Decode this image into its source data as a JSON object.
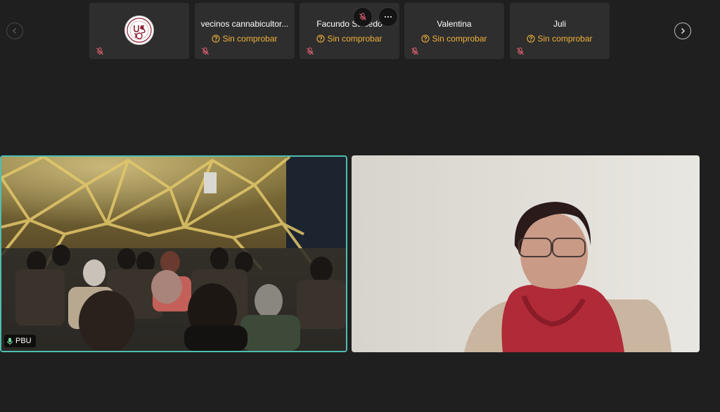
{
  "navigation": {
    "prev_icon": "chevron-left-icon",
    "next_icon": "chevron-right-icon"
  },
  "participants": [
    {
      "name": "",
      "avatar": "university-logo",
      "status": "",
      "muted": true
    },
    {
      "name": "vecinos cannabicultor...",
      "status": "Sin comprobar",
      "muted": true
    },
    {
      "name": "Facundo Salcedo",
      "status": "Sin comprobar",
      "muted": true
    },
    {
      "name": "Valentina",
      "status": "Sin comprobar",
      "muted": true
    },
    {
      "name": "Juli",
      "status": "Sin comprobar",
      "muted": true
    }
  ],
  "tile_overlay": {
    "mute_icon": "mic-off-icon",
    "more_icon": "more-options-icon"
  },
  "videos": [
    {
      "label": "PBU",
      "speaking": true,
      "mic_icon": "mic-on-icon"
    },
    {
      "label": "",
      "speaking": false
    }
  ],
  "colors": {
    "background": "#1f1f1f",
    "tile": "#2e2e2e",
    "status": "#f2b23a",
    "mute": "#e06070",
    "speaking_border": "#4dbfb2"
  }
}
